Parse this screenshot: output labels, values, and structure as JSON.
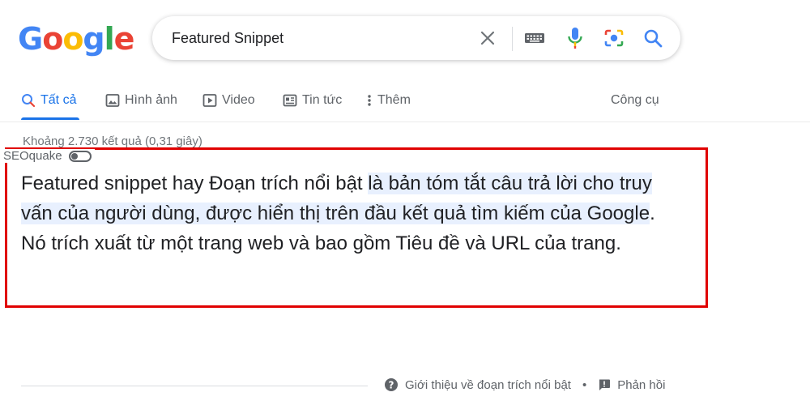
{
  "logo": {
    "letters": [
      "G",
      "o",
      "o",
      "g",
      "l",
      "e"
    ],
    "colors": [
      "#4285F4",
      "#EA4335",
      "#FBBC05",
      "#4285F4",
      "#34A853",
      "#EA4335"
    ]
  },
  "search": {
    "query": "Featured Snippet",
    "icons": [
      "close-icon",
      "keyboard-icon",
      "mic-icon",
      "camera-icon",
      "search-icon"
    ]
  },
  "tabs": {
    "all": "Tất cả",
    "images": "Hình ảnh",
    "video": "Video",
    "news": "Tin tức",
    "more": "Thêm",
    "tools": "Công cụ",
    "accent": "#1a73e8"
  },
  "results": {
    "stats": "Khoảng 2.730 kết quả (0,31 giây)"
  },
  "seoquake": {
    "label": "SEOquake"
  },
  "snippet": {
    "part1": "Featured snippet hay Đoạn trích nổi bật ",
    "highlight": "là bản tóm tắt câu trả lời cho truy vấn của người dùng, được hiển thị trên đầu kết quả tìm kiếm của Google",
    "part2": ". Nó trích xuất từ một trang web và bao gồm Tiêu đề và URL của trang.",
    "box_color": "#e00000"
  },
  "footer": {
    "about": "Giới thiệu về đoạn trích nổi bật",
    "separator": "•",
    "feedback": "Phản hồi"
  }
}
